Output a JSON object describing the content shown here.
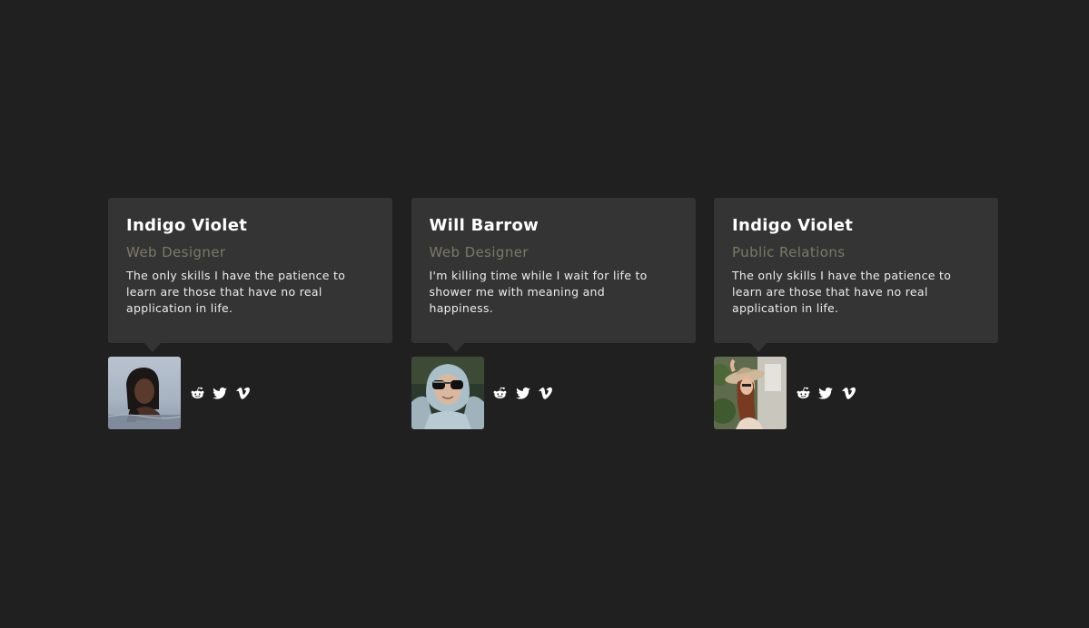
{
  "members": [
    {
      "name": "Indigo Violet",
      "role": "Web Designer",
      "bio": "The only skills I have the patience to learn are those that have no real application in life.",
      "avatar": "woman-in-water-photo",
      "socials": [
        "reddit-icon",
        "twitter-icon",
        "vimeo-icon"
      ]
    },
    {
      "name": "Will Barrow",
      "role": "Web Designer",
      "bio": "I'm killing time while I wait for life to shower me with meaning and happiness.",
      "avatar": "man-in-hoodie-sunglasses-photo",
      "socials": [
        "reddit-icon",
        "twitter-icon",
        "vimeo-icon"
      ]
    },
    {
      "name": "Indigo Violet",
      "role": "Public Relations",
      "bio": "The only skills I have the patience to learn are those that have no real application in life.",
      "avatar": "woman-in-hat-photo",
      "socials": [
        "reddit-icon",
        "twitter-icon",
        "vimeo-icon"
      ]
    }
  ],
  "colors": {
    "background": "#202020",
    "card": "#343434",
    "name": "#ffffff",
    "role": "#7b7a66",
    "bio": "#ececec",
    "icon": "#ffffff"
  }
}
